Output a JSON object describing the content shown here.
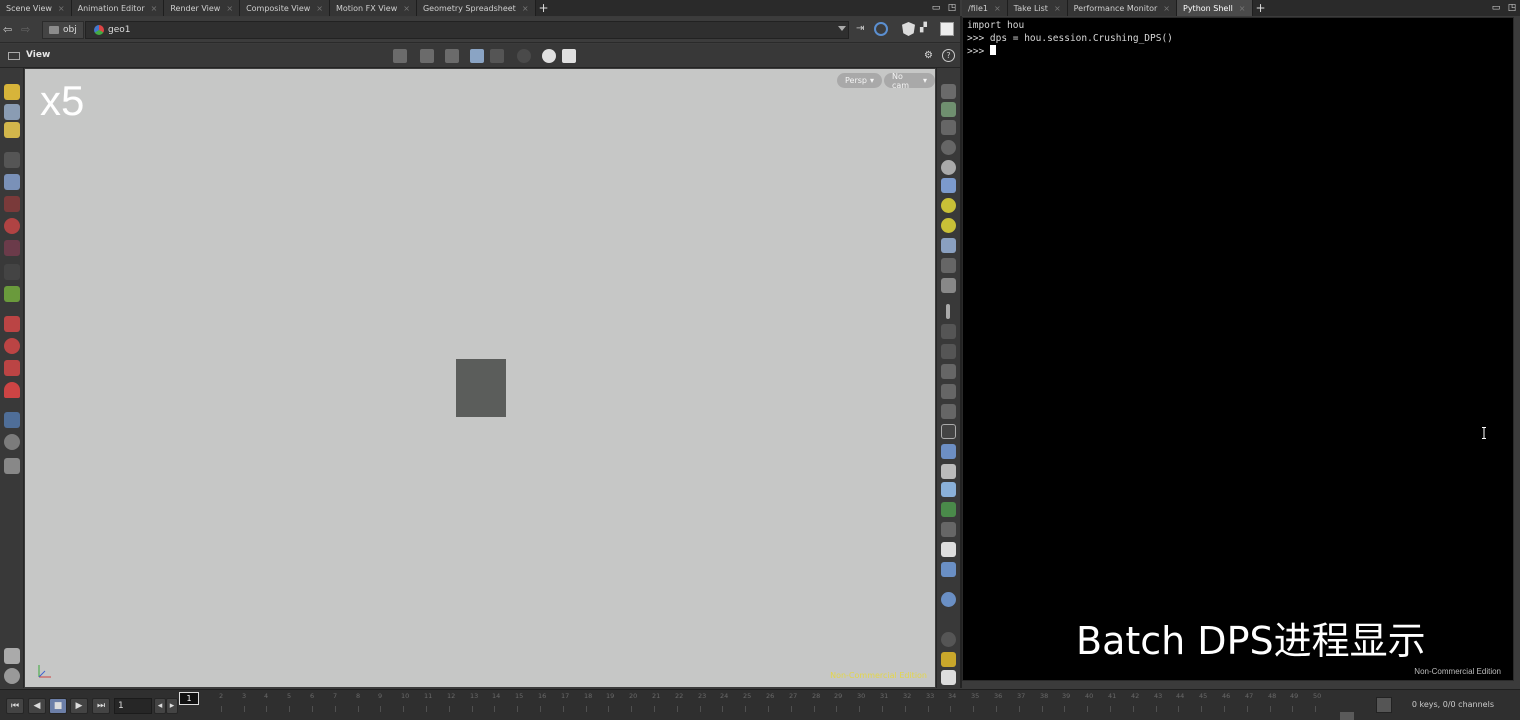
{
  "left_tabs": [
    {
      "label": "Scene View",
      "active": false
    },
    {
      "label": "Animation Editor",
      "active": false
    },
    {
      "label": "Render View",
      "active": false
    },
    {
      "label": "Composite View",
      "active": false
    },
    {
      "label": "Motion FX View",
      "active": false
    },
    {
      "label": "Geometry Spreadsheet",
      "active": false
    }
  ],
  "right_tabs": [
    {
      "label": "/file1",
      "active": false
    },
    {
      "label": "Take List",
      "active": false
    },
    {
      "label": "Performance Monitor",
      "active": false
    },
    {
      "label": "Python Shell",
      "active": true
    }
  ],
  "path": {
    "obj": "obj",
    "geo": "geo1"
  },
  "view": {
    "label": "View",
    "speed_badge": "x5",
    "persp": "Persp",
    "cam": "No cam",
    "edition": "Non-Commercial Edition"
  },
  "shell": {
    "lines": [
      "import hou",
      ">>> dps = hou.session.Crushing_DPS()",
      ">>> "
    ],
    "overlay": "Batch DPS进程显示",
    "edition": "Non-Commercial Edition"
  },
  "timeline": {
    "current_frame": "1",
    "frame_field": "1",
    "ticks": [
      "2",
      "3",
      "4",
      "5",
      "6",
      "7",
      "8",
      "9",
      "10",
      "11",
      "12",
      "13",
      "14",
      "15",
      "16",
      "17",
      "18",
      "19",
      "20",
      "21",
      "22",
      "23",
      "24",
      "25",
      "26",
      "27",
      "28",
      "29",
      "30",
      "31",
      "32",
      "33",
      "34",
      "35",
      "36",
      "37",
      "38",
      "39",
      "40",
      "41",
      "42",
      "43",
      "44",
      "45",
      "46",
      "47",
      "48",
      "49",
      "50"
    ],
    "keys": "0 keys, 0/0 channels"
  },
  "colors": {
    "viewport_bg": "#c6c7c6",
    "edition_yellow": "#e3d64a",
    "shell_bg": "#000000"
  }
}
